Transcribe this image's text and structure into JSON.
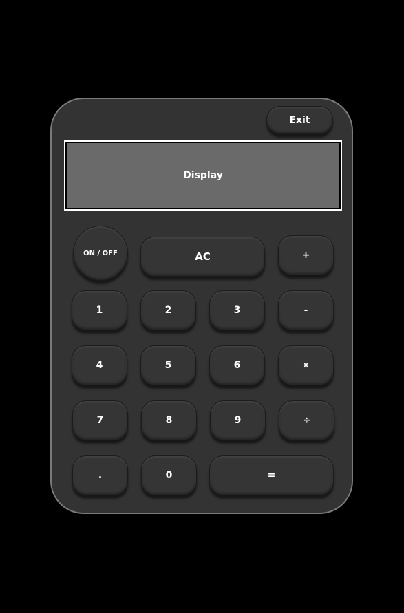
{
  "header": {
    "exit_label": "Exit"
  },
  "display": {
    "text": "Display"
  },
  "keys": {
    "power": "ON / OFF",
    "clear": "AC",
    "plus": "+",
    "minus": "-",
    "multiply": "×",
    "divide": "÷",
    "one": "1",
    "two": "2",
    "three": "3",
    "four": "4",
    "five": "5",
    "six": "6",
    "seven": "7",
    "eight": "8",
    "nine": "9",
    "zero": "0",
    "decimal": ".",
    "equals": "="
  },
  "colors": {
    "background": "#000000",
    "body": "#333333",
    "key": "#353535",
    "display": "#6a6a6a",
    "text": "#ffffff"
  }
}
